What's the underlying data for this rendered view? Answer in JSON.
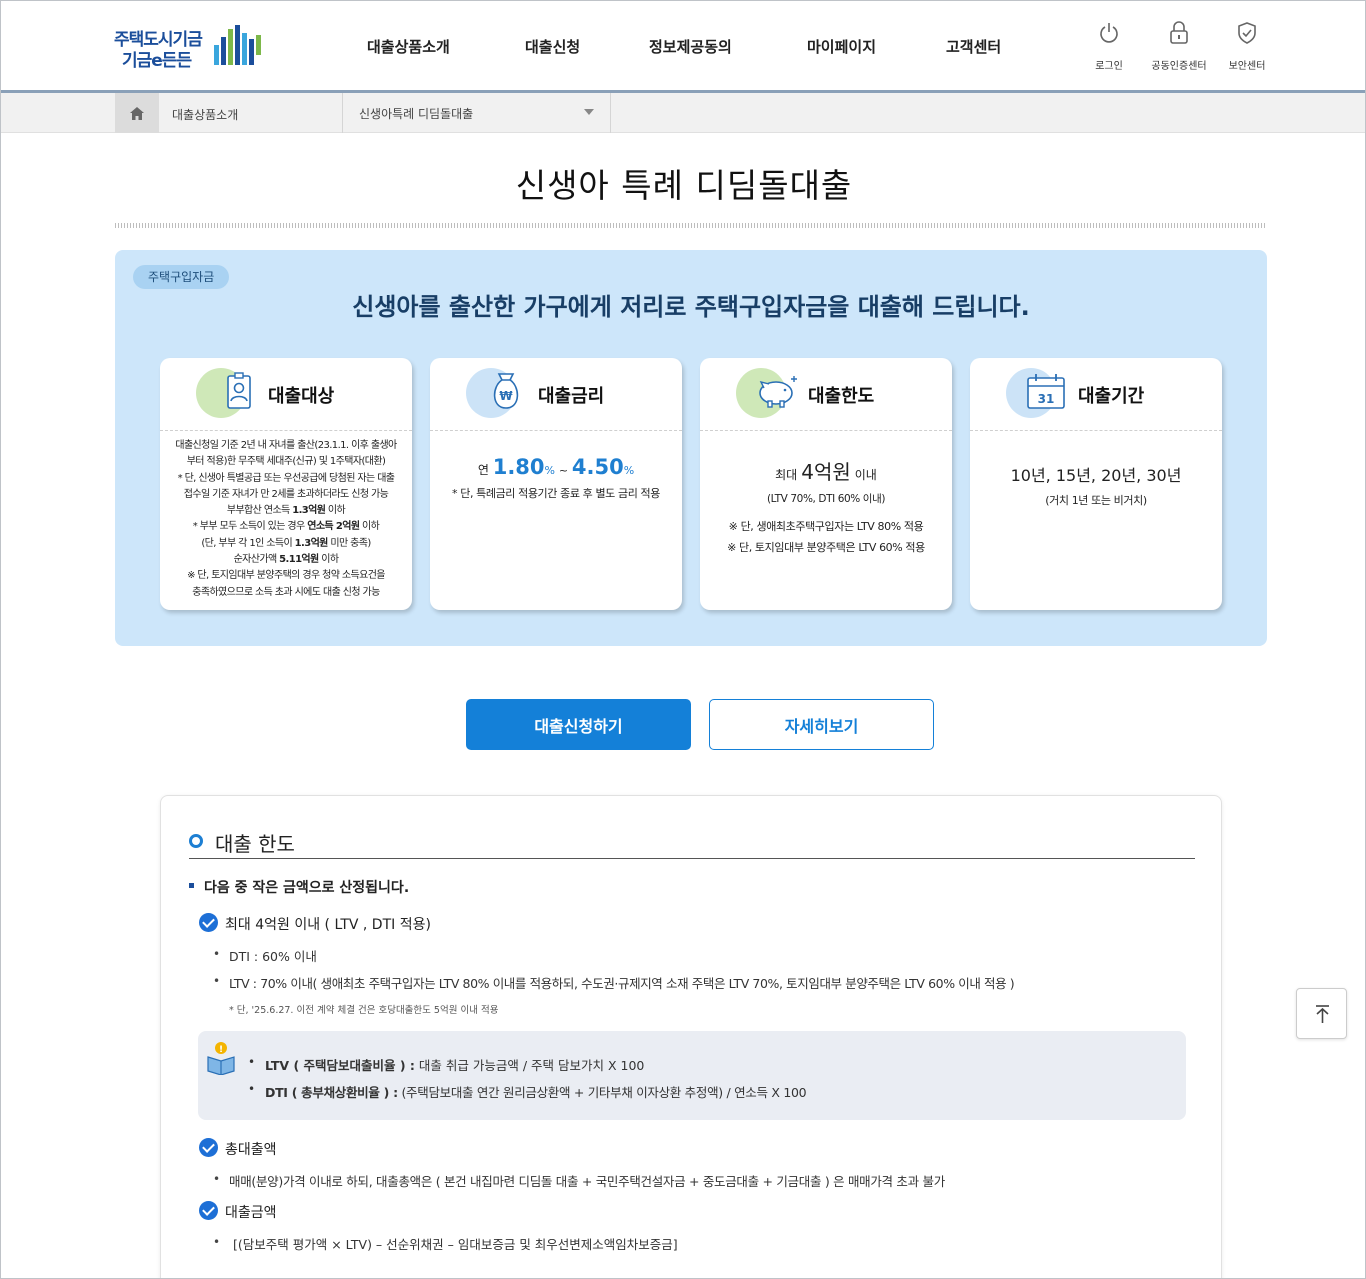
{
  "header": {
    "logo_line1": "주택도시기금",
    "logo_line2": "기금e든든",
    "nav": [
      "대출상품소개",
      "대출신청",
      "정보제공동의",
      "마이페이지",
      "고객센터"
    ],
    "util": {
      "login": "로그인",
      "cert": "공동인증센터",
      "security": "보안센터"
    }
  },
  "breadcrumb": {
    "level1": "대출상품소개",
    "level2": "신생아특례 디딤돌대출"
  },
  "page_title": "신생아 특례 디딤돌대출",
  "panel": {
    "tag": "주택구입자금",
    "lead": "신생아를 출산한 가구에게 저리로 주택구입자금을 대출해 드립니다.",
    "cards": {
      "target": {
        "title": "대출대상",
        "lines": [
          "대출신청일 기준 2년 내 자녀를 출산(23.1.1. 이후 출생아",
          "부터 적용)한 무주택 세대주(신규) 및 1주택자(대환)",
          "* 단, 신생아 특별공급 또는 우선공급에 당첨된 자는 대출",
          "접수일 기준 자녀가 만 2세를 초과하더라도 신청 가능"
        ],
        "income_pre": "부부합산 연소득 ",
        "income_bold": "1.3억원",
        "income_post": " 이하",
        "dual_pre": "* 부부 모두 소득이 있는 경우 ",
        "dual_bold": "연소득 2억원",
        "dual_post": " 이하",
        "each_pre": "(단, 부부 각 1인 소득이 ",
        "each_bold": "1.3억원",
        "each_post": " 미만 충족)",
        "asset_pre": "순자산가액 ",
        "asset_bold": "5.11억원",
        "asset_post": " 이하",
        "note1": "※ 단, 토지임대부 분양주택의 경우 청약 소득요건을",
        "note2": "충족하였으므로 소득 초과 시에도 대출 신청 가능"
      },
      "rate": {
        "title": "대출금리",
        "prefix": "연",
        "min": "1.80",
        "max": "4.50",
        "pct": "%",
        "sep": "~",
        "note": "* 단, 특례금리 적용기간 종료 후 별도 금리 적용"
      },
      "limit": {
        "title": "대출한도",
        "pre": "최대",
        "amount": "4억원",
        "post": "이내",
        "sub": "(LTV 70%, DTI 60% 이내)",
        "note1": "※ 단, 생애최초주택구입자는 LTV 80% 적용",
        "note2": "※ 단, 토지임대부 분양주택은 LTV 60% 적용"
      },
      "period": {
        "title": "대출기간",
        "cal_day": "31",
        "value": "10년, 15년, 20년, 30년",
        "sub": "(거치 1년 또는 비거치)"
      }
    }
  },
  "buttons": {
    "apply": "대출신청하기",
    "more": "자세히보기"
  },
  "detail": {
    "title": "대출 한도",
    "intro": "다음 중 작은 금액으로 산정됩니다.",
    "item1": {
      "head": "최대 4억원 이내 ( LTV , DTI 적용)",
      "b1": "DTI : 60% 이내",
      "b2": "LTV : 70% 이내( 생애최초 주택구입자는 LTV 80% 이내를 적용하되, 수도권·규제지역 소재 주택은 LTV 70%, 토지임대부 분양주택은 LTV 60% 이내 적용 )",
      "note": "* 단, '25.6.27. 이전 계약 체결 건은 호당대출한도 5억원 이내 적용"
    },
    "info": {
      "ltv_label": "LTV ( 주택담보대출비율 ) :",
      "ltv_text": "대출 취급 가능금액 / 주택 담보가치 X 100",
      "dti_label": "DTI ( 총부채상환비율 ) :",
      "dti_text": "(주택담보대출 연간 원리금상환액 + 기타부채 이자상환 추정액) / 연소득 X 100"
    },
    "item2": {
      "head": "총대출액",
      "b1": "매매(분양)가격 이내로 하되, 대출총액은 ( 본건 내집마련 디딤돌 대출 + 국민주택건설자금 + 중도금대출 + 기금대출 ) 은 매매가격 초과 불가"
    },
    "item3": {
      "head": "대출금액",
      "b1": "[(담보주택 평가액 × LTV) – 선순위채권 – 임대보증금 및 최우선변제소액임차보증금]"
    }
  },
  "colors": {
    "primary": "#1480d8",
    "panel_bg": "#cde6fa",
    "brand": "#1b4e9b",
    "check": "#1d6fd6"
  },
  "icons": [
    "home-icon",
    "power-icon",
    "lock-icon",
    "shield-icon",
    "id-card-icon",
    "money-bag-icon",
    "piggy-bank-icon",
    "calendar-icon",
    "info-book-icon",
    "check-icon",
    "arrow-up-icon"
  ]
}
